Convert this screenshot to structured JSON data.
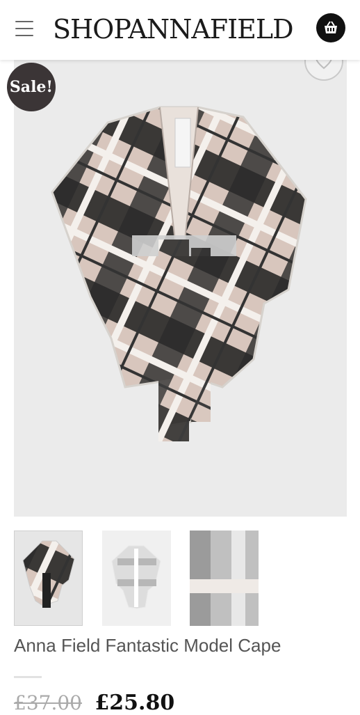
{
  "header": {
    "logo_text": "SHOPANNAFIELD",
    "menu_icon": "hamburger-icon",
    "cart_icon": "basket-icon"
  },
  "product": {
    "badge": "Sale!",
    "title": "Anna Field Fantastic Model Cape",
    "price_old": "£37.00",
    "price_new": "£25.80",
    "thumbnail_count": 3
  },
  "colors": {
    "badge_bg": "#3b3536",
    "logo_text": "#1b1b1b",
    "price": "#111111",
    "price_old": "#aaaaaa"
  }
}
